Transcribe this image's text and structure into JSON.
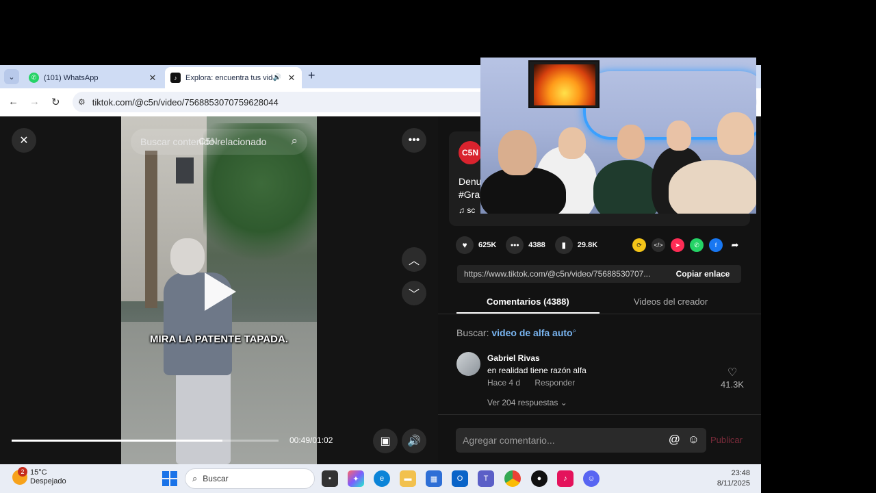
{
  "browser": {
    "tabs": [
      {
        "title": "(101) WhatsApp"
      },
      {
        "title": "Explora: encuentra tus vide"
      }
    ],
    "url": "tiktok.com/@c5n/video/7568853070759628044"
  },
  "player": {
    "search_placeholder": "Buscar contenido relacionado",
    "watermark": "C5N",
    "caption": "MIRA LA PATENTE TAPADA.",
    "time": "00:49/01:02",
    "progress_fraction": 0.79
  },
  "post": {
    "author_logo": "C5N",
    "desc_line1": "Denu",
    "desc_line2": "#Gra",
    "music": "sc"
  },
  "actions": {
    "likes": "625K",
    "comments": "4388",
    "saves": "29.8K"
  },
  "share": {
    "link": "https://www.tiktok.com/@c5n/video/75688530707...",
    "copy_label": "Copiar enlace"
  },
  "tabs": {
    "comments": "Comentarios (4388)",
    "creator_videos": "Videos del creador"
  },
  "search_suggestion": {
    "prefix": "Buscar:",
    "query": "video de alfa auto"
  },
  "comment": {
    "user": "Gabriel Rivas",
    "text": "en realidad tiene razón alfa",
    "time": "Hace 4 d",
    "reply": "Responder",
    "replies": "Ver 204 respuestas",
    "likes": "41.3K"
  },
  "composer": {
    "placeholder": "Agregar comentario...",
    "publish": "Publicar"
  },
  "taskbar": {
    "weather_temp": "15°C",
    "weather_desc": "Despejado",
    "weather_badge": "2",
    "search": "Buscar",
    "time": "23:48",
    "date": "8/11/2025"
  }
}
